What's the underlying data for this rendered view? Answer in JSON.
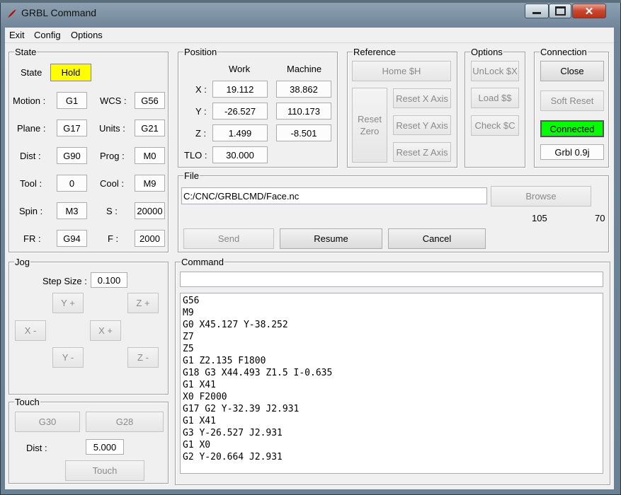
{
  "window": {
    "title": "GRBL Command"
  },
  "menu": [
    "Exit",
    "Config",
    "Options"
  ],
  "state": {
    "group": "State",
    "state_label": "State",
    "state_value": "Hold",
    "state_color": "#ffff00",
    "motion_label": "Motion :",
    "motion": "G1",
    "wcs_label": "WCS :",
    "wcs": "G56",
    "plane_label": "Plane :",
    "plane": "G17",
    "units_label": "Units :",
    "units": "G21",
    "dist_label": "Dist :",
    "dist": "G90",
    "prog_label": "Prog :",
    "prog": "M0",
    "tool_label": "Tool :",
    "tool": "0",
    "cool_label": "Cool :",
    "cool": "M9",
    "spin_label": "Spin :",
    "spin": "M3",
    "s_label": "S :",
    "s": "20000",
    "fr_label": "FR :",
    "fr": "G94",
    "f_label": "F :",
    "f": "2000"
  },
  "position": {
    "group": "Position",
    "work_header": "Work",
    "machine_header": "Machine",
    "x_label": "X :",
    "x_work": "19.112",
    "x_machine": "38.862",
    "y_label": "Y :",
    "y_work": "-26.527",
    "y_machine": "110.173",
    "z_label": "Z :",
    "z_work": "1.499",
    "z_machine": "-8.501",
    "tlo_label": "TLO :",
    "tlo": "30.000"
  },
  "reference": {
    "group": "Reference",
    "home": "Home $H",
    "reset_zero": "Reset\nZero",
    "reset_x": "Reset X Axis",
    "reset_y": "Reset Y Axis",
    "reset_z": "Reset Z Axis"
  },
  "options": {
    "group": "Options",
    "unlock": "UnLock $X",
    "load": "Load $$",
    "check": "Check $C"
  },
  "connection": {
    "group": "Connection",
    "close": "Close",
    "soft_reset": "Soft Reset",
    "status": "Connected",
    "status_color": "#00ff00",
    "version": "Grbl 0.9j"
  },
  "file": {
    "group": "File",
    "path": "C:/CNC/GRBLCMD/Face.nc",
    "browse": "Browse",
    "line_current": "105",
    "line_total": "70",
    "send": "Send",
    "resume": "Resume",
    "cancel": "Cancel"
  },
  "jog": {
    "group": "Jog",
    "step_label": "Step Size :",
    "step": "0.100",
    "y_plus": "Y +",
    "z_plus": "Z +",
    "x_minus": "X -",
    "x_plus": "X +",
    "y_minus": "Y -",
    "z_minus": "Z -"
  },
  "touch": {
    "group": "Touch",
    "g30": "G30",
    "g28": "G28",
    "dist_label": "Dist :",
    "dist": "5.000",
    "touch": "Touch"
  },
  "command": {
    "group": "Command",
    "input": "",
    "lines": [
      "G56",
      "M9",
      "G0 X45.127 Y-38.252",
      "Z7",
      "Z5",
      "G1 Z2.135 F1800",
      "G18 G3 X44.493 Z1.5 I-0.635",
      "G1 X41",
      "X0 F2000",
      "G17 G2 Y-32.39 J2.931",
      "G1 X41",
      "G3 Y-26.527 J2.931",
      "G1 X0",
      "G2 Y-20.664 J2.931"
    ]
  }
}
